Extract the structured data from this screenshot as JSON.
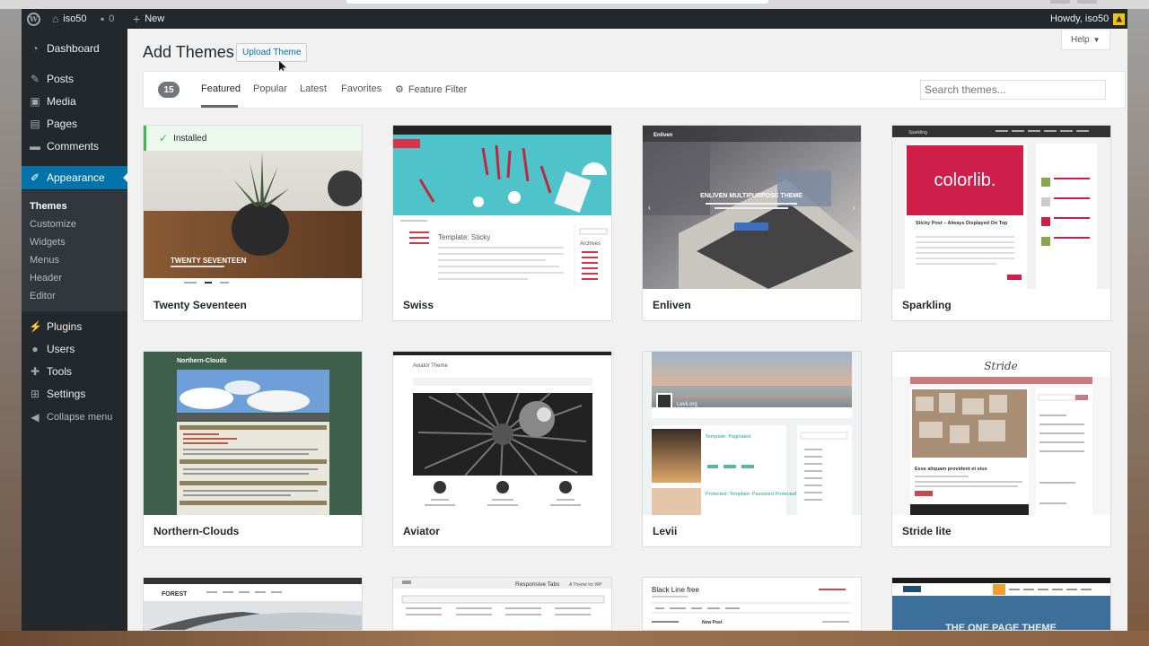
{
  "adminbar": {
    "site_name": "iso50",
    "comment_count": "0",
    "new_label": "New",
    "howdy": "Howdy, iso50"
  },
  "sidebar": {
    "dashboard": "Dashboard",
    "posts": "Posts",
    "media": "Media",
    "pages": "Pages",
    "comments": "Comments",
    "appearance": "Appearance",
    "sub": {
      "themes": "Themes",
      "customize": "Customize",
      "widgets": "Widgets",
      "menus": "Menus",
      "header": "Header",
      "editor": "Editor"
    },
    "plugins": "Plugins",
    "users": "Users",
    "tools": "Tools",
    "settings": "Settings",
    "collapse": "Collapse menu"
  },
  "page": {
    "title": "Add Themes",
    "upload_label": "Upload Theme",
    "help_label": "Help"
  },
  "filter": {
    "count": "15",
    "tabs": [
      "Featured",
      "Popular",
      "Latest",
      "Favorites",
      "Feature Filter"
    ],
    "search_placeholder": "Search themes..."
  },
  "themes": [
    {
      "name": "Twenty Seventeen",
      "installed_label": "Installed",
      "shot_title": "TWENTY SEVENTEEN"
    },
    {
      "name": "Swiss",
      "shot_title": "Template: Sticky",
      "sidebar_title": "Archives"
    },
    {
      "name": "Enliven",
      "shot_title": "ENLIVEN MULTIPURPOSE THEME"
    },
    {
      "name": "Sparkling",
      "shot_title": "colorlib.",
      "post_title": "Sticky Post – Always Displayed On Top"
    },
    {
      "name": "Northern-Clouds",
      "shot_title": "Northern-Clouds"
    },
    {
      "name": "Aviator",
      "shot_title": "Aviator Theme"
    },
    {
      "name": "Levii",
      "shot_title": "Template: Paginated",
      "shot_sub": "Protected: Template: Password Protected (the password is \"enter\")"
    },
    {
      "name": "Stride lite",
      "shot_title": "Stride",
      "post_title": "Esse aliquam provident et eius"
    }
  ],
  "partial_themes": [
    {
      "shot_title": "FOREST"
    },
    {
      "shot_title": "Responsive Tabs",
      "shot_sub": "A Theme for WP"
    },
    {
      "shot_title": "Black Line free",
      "shot_sub": "New Post"
    },
    {
      "shot_title": "THE ONE PAGE THEME"
    }
  ],
  "colors": {
    "admin_bg": "#23282d",
    "accent": "#0073aa",
    "installed_green": "#46b450"
  }
}
